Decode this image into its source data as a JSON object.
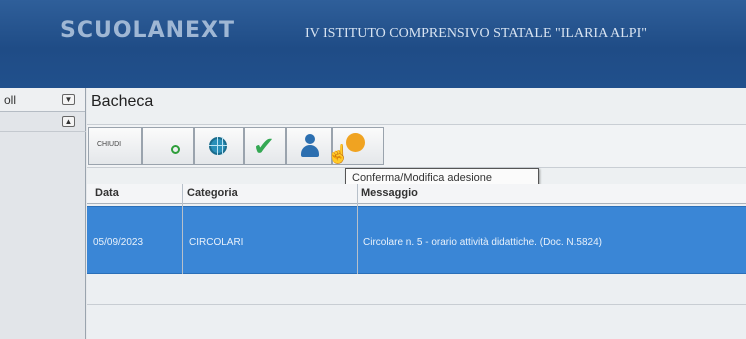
{
  "header": {
    "logo": "SCUOLANEXT",
    "school_name": "IV ISTITUTO COMPRENSIVO STATALE \"ILARIA ALPI\""
  },
  "left_panel": {
    "label": "oll",
    "collapse_glyph": "▼",
    "expand_glyph": "▲"
  },
  "main": {
    "title": "Bacheca",
    "toolbar": {
      "close_label": "CHIUDI",
      "tooltip": "Conferma/Modifica adesione"
    },
    "table": {
      "columns": [
        "Data",
        "Categoria",
        "Messaggio"
      ],
      "rows": [
        {
          "date": "05/09/2023",
          "category": "CIRCOLARI",
          "message": "Circolare n. 5 - orario attività didattiche. (Doc. N.5824)"
        }
      ]
    }
  },
  "colors": {
    "header_blue": "#1f4c86",
    "selected_row": "#3a86d6",
    "accent_green": "#34a853",
    "accent_orange": "#f0a321"
  },
  "icons": [
    "new-icon",
    "globe-icon",
    "checkmark-icon",
    "person-icon",
    "hand-cursor-icon",
    "status-dot-icon"
  ]
}
